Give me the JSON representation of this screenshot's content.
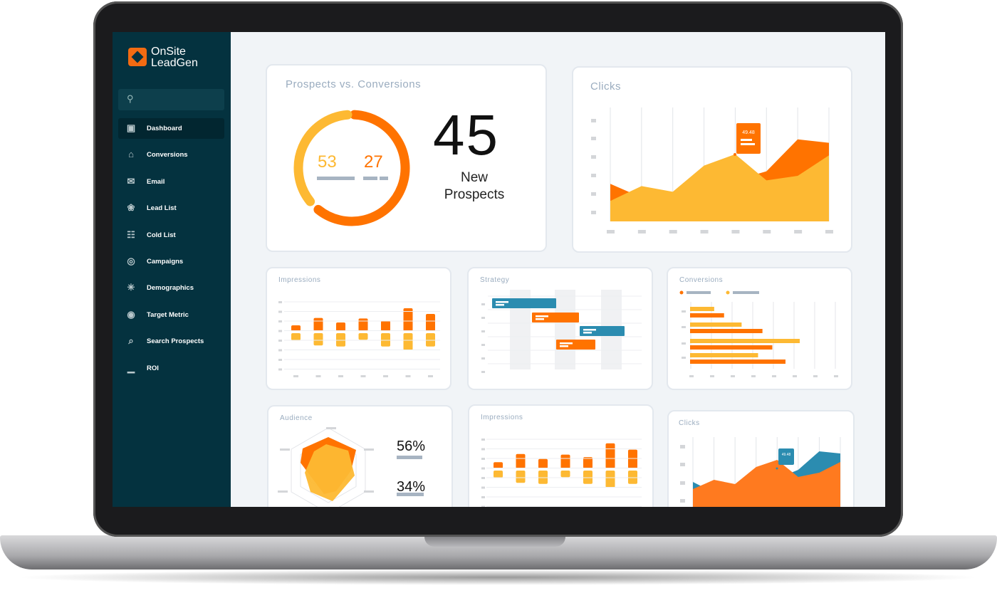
{
  "brand": {
    "line1": "OnSite",
    "line2": "LeadGen",
    "logo_color": "#f26b12"
  },
  "search": {
    "placeholder": "",
    "icon": "search-icon"
  },
  "sidebar": {
    "items": [
      {
        "label": "Dashboard",
        "icon": "dashboard-gauge-icon",
        "active": true
      },
      {
        "label": "Conversions",
        "icon": "tags-icon"
      },
      {
        "label": "Email",
        "icon": "envelope-icon"
      },
      {
        "label": "Lead List",
        "icon": "network-icon"
      },
      {
        "label": "Cold List",
        "icon": "hierarchy-icon"
      },
      {
        "label": "Campaigns",
        "icon": "target-cursor-icon"
      },
      {
        "label": "Demographics",
        "icon": "cursor-burst-icon"
      },
      {
        "label": "Target Metric",
        "icon": "bullseye-icon"
      },
      {
        "label": "Search Prospects",
        "icon": "search-chart-icon"
      },
      {
        "label": "ROI",
        "icon": "bar-growth-icon"
      }
    ]
  },
  "colors": {
    "orange": "#ff7300",
    "yellow": "#fdb933",
    "blue": "#2b8cb0",
    "sidebar": "#04323f",
    "placeholder": "#a7b4c2"
  },
  "prospects": {
    "title": "Prospects vs. Conversions",
    "left_value": "53",
    "right_value": "27",
    "big_number": "45",
    "big_label_1": "New",
    "big_label_2": "Prospects",
    "donut_fractions": {
      "yellow": 0.35,
      "orange": 0.6
    }
  },
  "clicks": {
    "title": "Clicks",
    "tooltip": "49.48",
    "series_back": [
      33,
      21,
      13,
      41,
      36,
      44,
      72,
      69
    ],
    "series_front": [
      18,
      31,
      26,
      49,
      59,
      36,
      40,
      58
    ]
  },
  "impressions": {
    "title": "Impressions",
    "up": [
      20,
      46,
      30,
      44,
      36,
      80,
      60
    ],
    "down": [
      25,
      43,
      47,
      23,
      47,
      60,
      47
    ]
  },
  "strategy": {
    "title": "Strategy"
  },
  "conversions": {
    "title": "Conversions",
    "yellow": [
      22,
      47,
      100,
      62
    ],
    "orange": [
      31,
      66,
      75,
      87
    ]
  },
  "audience": {
    "title": "Audience",
    "stat1": "56%",
    "stat2": "34%"
  },
  "impressions2": {
    "title": "Impressions"
  },
  "clicks2": {
    "title": "Clicks",
    "tooltip": "49.48"
  }
}
